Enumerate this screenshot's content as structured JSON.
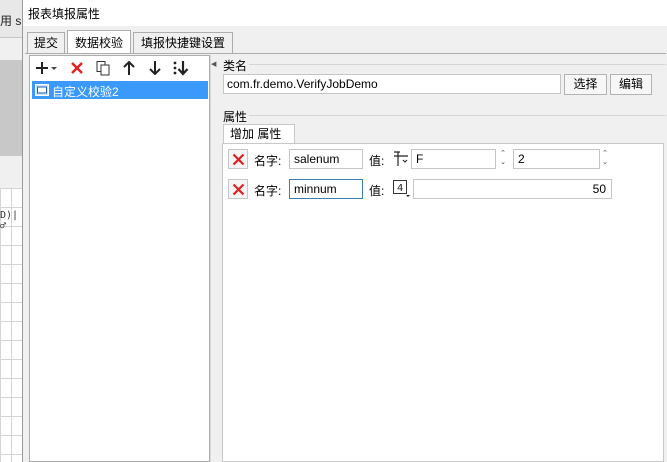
{
  "background": {
    "top_text": "用 s",
    "cell_text": "D)|♂"
  },
  "dialog": {
    "title": "报表填报属性"
  },
  "tabs": [
    {
      "label": "提交",
      "active": false
    },
    {
      "label": "数据校验",
      "active": true
    },
    {
      "label": "填报快捷键设置",
      "active": false
    }
  ],
  "toolbar": {
    "add": "add-icon",
    "delete": "delete-icon",
    "copy": "copy-icon",
    "up": "move-up-icon",
    "down": "move-down-icon",
    "sort": "sort-icon"
  },
  "tree": {
    "items": [
      {
        "label": "自定义校验2",
        "selected": true
      }
    ]
  },
  "class_section": {
    "label": "类名",
    "value": "com.fr.demo.VerifyJobDemo",
    "select_label": "选择",
    "edit_label": "编辑"
  },
  "props_section": {
    "label": "属性",
    "sub_tab_label": "增加 属性",
    "rows": [
      {
        "name_label": "名字:",
        "name_value": "salenum",
        "value_label": "值:",
        "type_icon": "formula-icon",
        "type_value": "F",
        "number_value": "2"
      },
      {
        "name_label": "名字:",
        "name_value": "minnum",
        "value_label": "值:",
        "type_icon": "integer-icon",
        "type_glyph": "4",
        "number_value": "50"
      }
    ]
  },
  "colors": {
    "selection": "#3b99fc",
    "delete_red": "#e02020"
  }
}
